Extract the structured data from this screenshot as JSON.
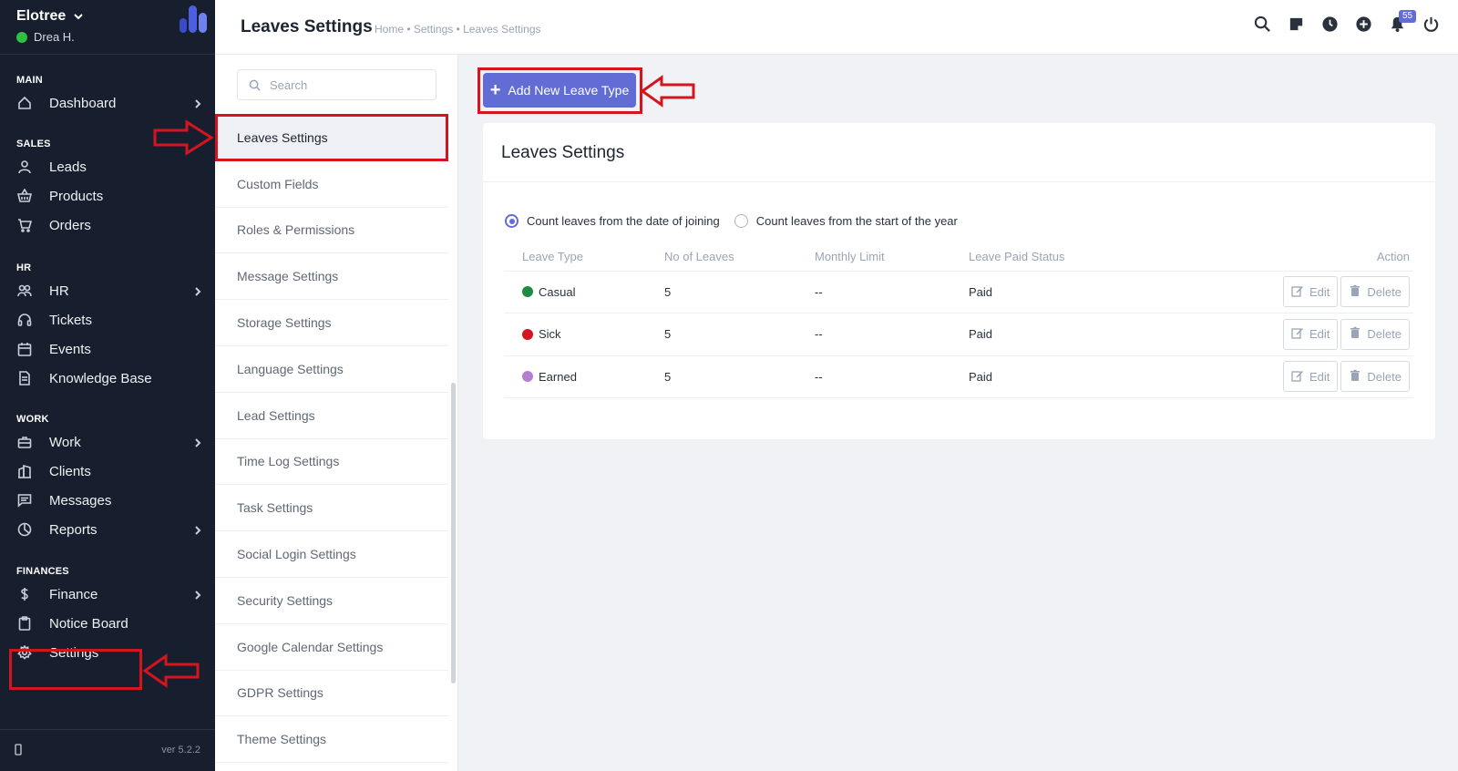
{
  "app": {
    "company": "Elotree",
    "user": "Drea H.",
    "version": "ver 5.2.2"
  },
  "sidebar": {
    "sections": [
      {
        "title": "MAIN",
        "items": [
          {
            "label": "Dashboard",
            "icon": "home-icon",
            "chevron": true
          }
        ]
      },
      {
        "title": "SALES",
        "items": [
          {
            "label": "Leads",
            "icon": "user-icon"
          },
          {
            "label": "Products",
            "icon": "basket-icon"
          },
          {
            "label": "Orders",
            "icon": "cart-icon"
          }
        ]
      },
      {
        "title": "HR",
        "items": [
          {
            "label": "HR",
            "icon": "people-icon",
            "chevron": true
          },
          {
            "label": "Tickets",
            "icon": "headset-icon"
          },
          {
            "label": "Events",
            "icon": "calendar-icon"
          },
          {
            "label": "Knowledge Base",
            "icon": "document-icon"
          }
        ]
      },
      {
        "title": "WORK",
        "items": [
          {
            "label": "Work",
            "icon": "briefcase-icon",
            "chevron": true
          },
          {
            "label": "Clients",
            "icon": "building-icon"
          },
          {
            "label": "Messages",
            "icon": "chat-icon"
          },
          {
            "label": "Reports",
            "icon": "pie-chart-icon",
            "chevron": true
          }
        ]
      },
      {
        "title": "FINANCES",
        "items": [
          {
            "label": "Finance",
            "icon": "dollar-icon",
            "chevron": true
          },
          {
            "label": "Notice Board",
            "icon": "clipboard-icon"
          },
          {
            "label": "Settings",
            "icon": "gear-icon"
          }
        ]
      }
    ]
  },
  "header": {
    "title": "Leaves Settings",
    "breadcrumb": "Home • Settings • Leaves Settings",
    "notification_count": "55",
    "icons": [
      "search-icon",
      "sticky-note-icon",
      "clock-icon",
      "plus-circle-icon",
      "bell-icon",
      "power-icon"
    ]
  },
  "submenu": {
    "search_placeholder": "Search",
    "items": [
      "Leaves Settings",
      "Custom Fields",
      "Roles & Permissions",
      "Message Settings",
      "Storage Settings",
      "Language Settings",
      "Lead Settings",
      "Time Log Settings",
      "Task Settings",
      "Social Login Settings",
      "Security Settings",
      "Google Calendar Settings",
      "GDPR Settings",
      "Theme Settings"
    ],
    "active": "Leaves Settings"
  },
  "main": {
    "add_button": "Add New Leave Type",
    "card_title": "Leaves Settings",
    "radio_options": [
      {
        "label": "Count leaves from the date of joining",
        "checked": true
      },
      {
        "label": "Count leaves from the start of the year",
        "checked": false
      }
    ],
    "table": {
      "headers": [
        "Leave Type",
        "No of Leaves",
        "Monthly Limit",
        "Leave Paid Status",
        "Action"
      ],
      "rows": [
        {
          "type": "Casual",
          "color": "#1e8a43",
          "leaves": "5",
          "monthly_limit": "--",
          "paid_status": "Paid"
        },
        {
          "type": "Sick",
          "color": "#d3151f",
          "leaves": "5",
          "monthly_limit": "--",
          "paid_status": "Paid"
        },
        {
          "type": "Earned",
          "color": "#b47fd1",
          "leaves": "5",
          "monthly_limit": "--",
          "paid_status": "Paid"
        }
      ],
      "edit_label": "Edit",
      "delete_label": "Delete"
    }
  },
  "colors": {
    "sidebar_bg": "#171f2e",
    "accent": "#616dd4",
    "annotation_red": "#d3151f"
  }
}
